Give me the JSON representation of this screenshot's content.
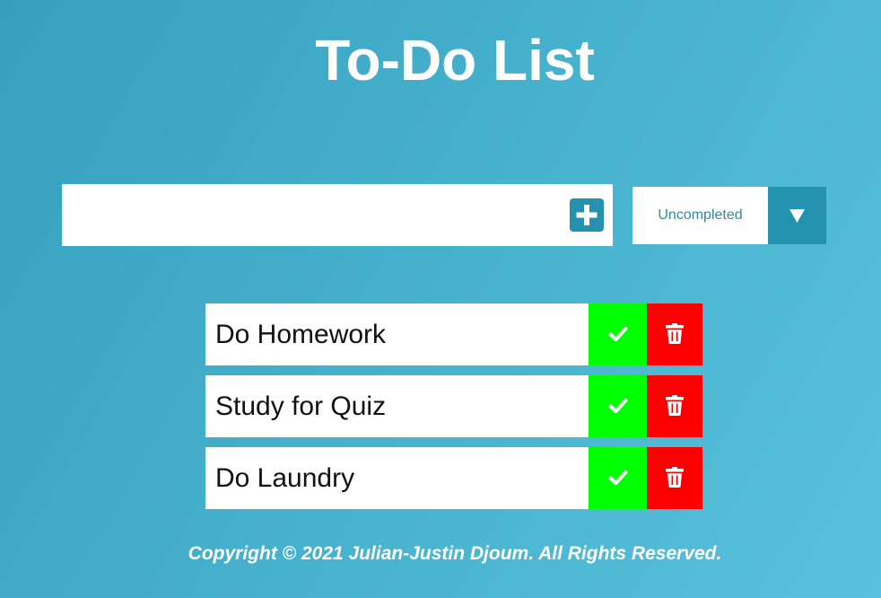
{
  "header": {
    "title": "To-Do List"
  },
  "form": {
    "input_value": "",
    "input_placeholder": "",
    "add_icon": "plus-square-icon",
    "filter_selected": "Uncompleted",
    "filter_icon": "triangle-down-icon"
  },
  "todos": [
    {
      "label": "Do Homework"
    },
    {
      "label": "Study for Quiz"
    },
    {
      "label": "Do Laundry"
    }
  ],
  "icons": {
    "complete": "check-icon",
    "delete": "trash-icon"
  },
  "footer": {
    "text": "Copyright © 2021 Julian-Justin Djoum. All Rights Reserved."
  },
  "colors": {
    "background_start": "#389fbf",
    "background_end": "#58c2dc",
    "accent": "#2491ae",
    "complete": "#00ff00",
    "delete": "#ff0000",
    "text_light": "#ffffff",
    "filter_text": "#2f8aa5"
  }
}
